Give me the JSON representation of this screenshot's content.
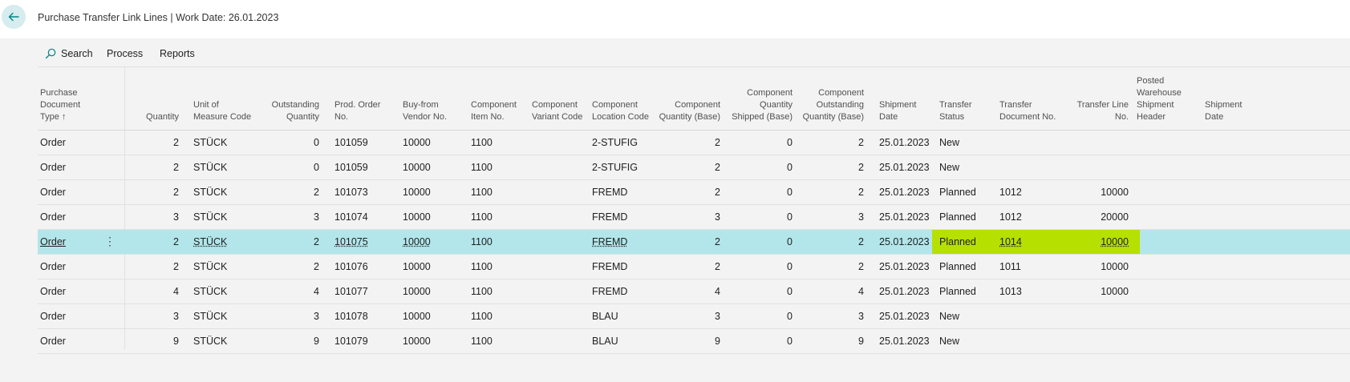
{
  "header": {
    "title": "Purchase Transfer Link Lines | Work Date: 26.01.2023"
  },
  "actions": {
    "search_label": "Search",
    "process_label": "Process",
    "reports_label": "Reports"
  },
  "columns": {
    "doc_type": [
      "Purchase",
      "Document",
      "Type ↑"
    ],
    "quantity": [
      "Quantity"
    ],
    "uom": [
      "Unit of",
      "Measure Code"
    ],
    "outstanding_qty": [
      "Outstanding",
      "Quantity"
    ],
    "prod_order": [
      "Prod. Order",
      "No."
    ],
    "vendor": [
      "Buy-from",
      "Vendor No."
    ],
    "comp_item": [
      "Component",
      "Item No."
    ],
    "comp_variant": [
      "Component",
      "Variant Code"
    ],
    "comp_location": [
      "Component",
      "Location Code"
    ],
    "comp_qty_base": [
      "Component",
      "Quantity (Base)"
    ],
    "comp_qty_shipped": [
      "Component",
      "Quantity",
      "Shipped (Base)"
    ],
    "comp_outstanding": [
      "Component",
      "Outstanding",
      "Quantity (Base)"
    ],
    "shipment_date": [
      "Shipment",
      "Date"
    ],
    "transfer_status": [
      "Transfer",
      "Status"
    ],
    "transfer_doc": [
      "Transfer",
      "Document No."
    ],
    "transfer_line": [
      "Transfer Line",
      "No."
    ],
    "posted_wh": [
      "Posted",
      "Warehouse",
      "Shipment",
      "Header"
    ],
    "shipment_date2": [
      "Shipment",
      "Date"
    ]
  },
  "rows": [
    {
      "doc_type": "Order",
      "quantity": "2",
      "uom": "STÜCK",
      "outstanding": "0",
      "prod_order": "101059",
      "vendor": "10000",
      "comp_item": "1100",
      "comp_variant": "",
      "comp_location": "2-STUFIG",
      "comp_qty_base": "2",
      "comp_shipped": "0",
      "comp_outstanding": "2",
      "shipment_date": "25.01.2023",
      "status": "New",
      "transfer_doc": "",
      "transfer_line": ""
    },
    {
      "doc_type": "Order",
      "quantity": "2",
      "uom": "STÜCK",
      "outstanding": "0",
      "prod_order": "101059",
      "vendor": "10000",
      "comp_item": "1100",
      "comp_variant": "",
      "comp_location": "2-STUFIG",
      "comp_qty_base": "2",
      "comp_shipped": "0",
      "comp_outstanding": "2",
      "shipment_date": "25.01.2023",
      "status": "New",
      "transfer_doc": "",
      "transfer_line": ""
    },
    {
      "doc_type": "Order",
      "quantity": "2",
      "uom": "STÜCK",
      "outstanding": "2",
      "prod_order": "101073",
      "vendor": "10000",
      "comp_item": "1100",
      "comp_variant": "",
      "comp_location": "FREMD",
      "comp_qty_base": "2",
      "comp_shipped": "0",
      "comp_outstanding": "2",
      "shipment_date": "25.01.2023",
      "status": "Planned",
      "transfer_doc": "1012",
      "transfer_line": "10000"
    },
    {
      "doc_type": "Order",
      "quantity": "3",
      "uom": "STÜCK",
      "outstanding": "3",
      "prod_order": "101074",
      "vendor": "10000",
      "comp_item": "1100",
      "comp_variant": "",
      "comp_location": "FREMD",
      "comp_qty_base": "3",
      "comp_shipped": "0",
      "comp_outstanding": "3",
      "shipment_date": "25.01.2023",
      "status": "Planned",
      "transfer_doc": "1012",
      "transfer_line": "20000"
    },
    {
      "doc_type": "Order",
      "quantity": "2",
      "uom": "STÜCK",
      "outstanding": "2",
      "prod_order": "101075",
      "vendor": "10000",
      "comp_item": "1100",
      "comp_variant": "",
      "comp_location": "FREMD",
      "comp_qty_base": "2",
      "comp_shipped": "0",
      "comp_outstanding": "2",
      "shipment_date": "25.01.2023",
      "status": "Planned",
      "transfer_doc": "1014",
      "transfer_line": "10000"
    },
    {
      "doc_type": "Order",
      "quantity": "2",
      "uom": "STÜCK",
      "outstanding": "2",
      "prod_order": "101076",
      "vendor": "10000",
      "comp_item": "1100",
      "comp_variant": "",
      "comp_location": "FREMD",
      "comp_qty_base": "2",
      "comp_shipped": "0",
      "comp_outstanding": "2",
      "shipment_date": "25.01.2023",
      "status": "Planned",
      "transfer_doc": "1011",
      "transfer_line": "10000"
    },
    {
      "doc_type": "Order",
      "quantity": "4",
      "uom": "STÜCK",
      "outstanding": "4",
      "prod_order": "101077",
      "vendor": "10000",
      "comp_item": "1100",
      "comp_variant": "",
      "comp_location": "FREMD",
      "comp_qty_base": "4",
      "comp_shipped": "0",
      "comp_outstanding": "4",
      "shipment_date": "25.01.2023",
      "status": "Planned",
      "transfer_doc": "1013",
      "transfer_line": "10000"
    },
    {
      "doc_type": "Order",
      "quantity": "3",
      "uom": "STÜCK",
      "outstanding": "3",
      "prod_order": "101078",
      "vendor": "10000",
      "comp_item": "1100",
      "comp_variant": "",
      "comp_location": "BLAU",
      "comp_qty_base": "3",
      "comp_shipped": "0",
      "comp_outstanding": "3",
      "shipment_date": "25.01.2023",
      "status": "New",
      "transfer_doc": "",
      "transfer_line": ""
    },
    {
      "doc_type": "Order",
      "quantity": "9",
      "uom": "STÜCK",
      "outstanding": "9",
      "prod_order": "101079",
      "vendor": "10000",
      "comp_item": "1100",
      "comp_variant": "",
      "comp_location": "BLAU",
      "comp_qty_base": "9",
      "comp_shipped": "0",
      "comp_outstanding": "9",
      "shipment_date": "25.01.2023",
      "status": "New",
      "transfer_doc": "",
      "transfer_line": ""
    }
  ],
  "selected_row": 4,
  "colors": {
    "selected_row": "#b2e6ea",
    "highlight": "#b6e000",
    "accent": "#008489"
  },
  "icons": {
    "back": "arrow-left-icon",
    "search": "search-icon",
    "row_menu": "more-vertical-icon"
  }
}
